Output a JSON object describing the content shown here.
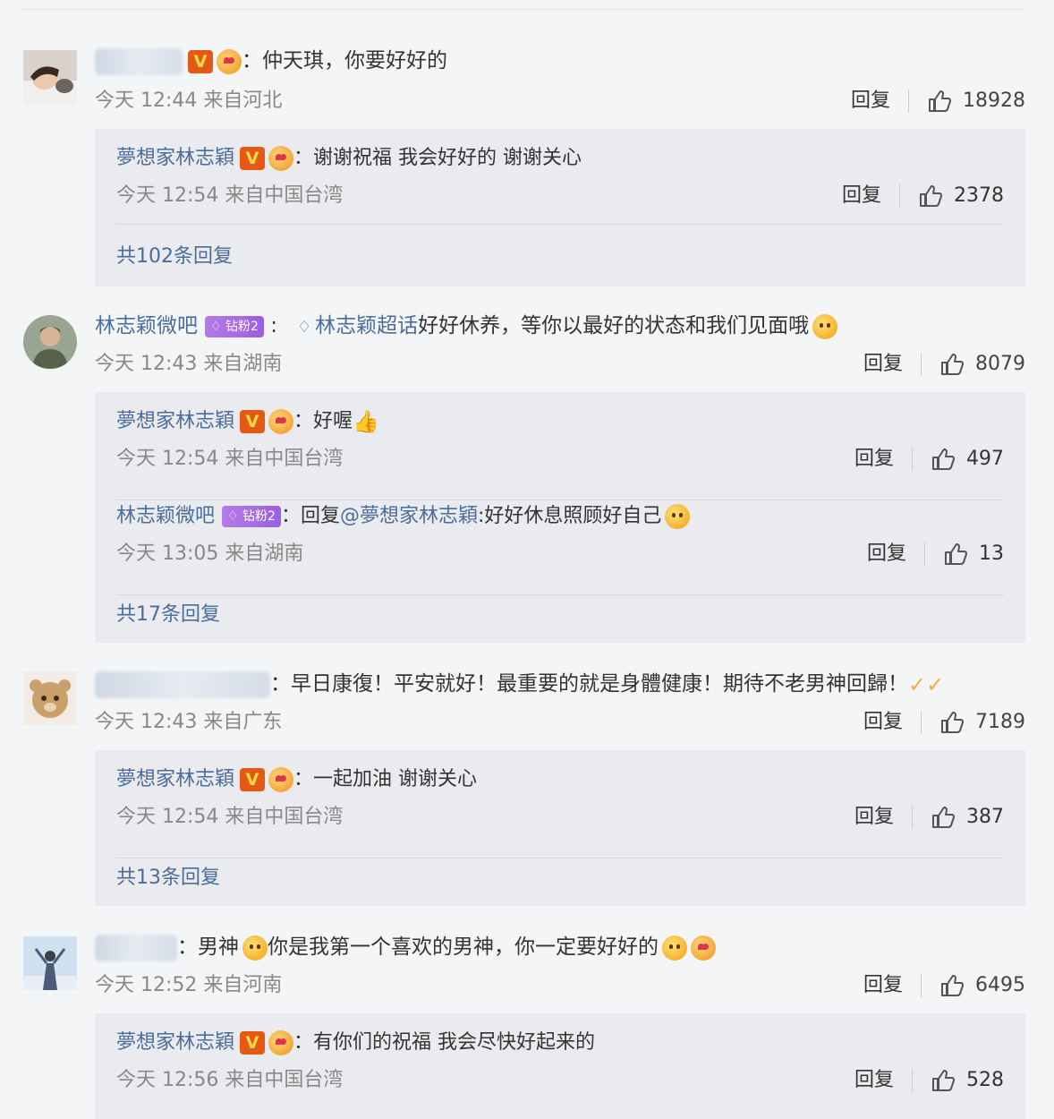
{
  "comments": [
    {
      "text": "：仲天琪，你要好好的",
      "meta": "今天 12:44 来自河北",
      "reply_label": "回复",
      "likes": "18928",
      "replies": [
        {
          "user": "夢想家林志穎",
          "text": "：谢谢祝福 我会好好的 谢谢关心",
          "meta": "今天 12:54 来自中国台湾",
          "reply_label": "回复",
          "likes": "2378"
        }
      ],
      "more": "共102条回复"
    },
    {
      "user": "林志颖微吧",
      "fan_badge": "钻粉2",
      "mention": "林志颖超话",
      "text": "好好休养，等你以最好的状态和我们见面哦",
      "meta": "今天 12:43 来自湖南",
      "reply_label": "回复",
      "likes": "8079",
      "replies": [
        {
          "user": "夢想家林志穎",
          "text": "：好喔",
          "meta": "今天 12:54 来自中国台湾",
          "reply_label": "回复",
          "likes": "497"
        },
        {
          "user": "林志颖微吧",
          "fan_badge": "钻粉2",
          "text_prefix": "：回复",
          "mention": "@夢想家林志穎",
          "text": ":好好休息照顾好自己",
          "meta": "今天 13:05 来自湖南",
          "reply_label": "回复",
          "likes": "13"
        }
      ],
      "more": "共17条回复"
    },
    {
      "text": "：早日康復！平安就好！最重要的就是身體健康！期待不老男神回歸！",
      "meta": "今天 12:43 来自广东",
      "reply_label": "回复",
      "likes": "7189",
      "replies": [
        {
          "user": "夢想家林志穎",
          "text": "：一起加油 谢谢关心",
          "meta": "今天 12:54 来自中国台湾",
          "reply_label": "回复",
          "likes": "387"
        }
      ],
      "more": "共13条回复"
    },
    {
      "text_a": "：男神",
      "text_b": "你是我第一个喜欢的男神，你一定要好好的",
      "meta": "今天 12:52 来自河南",
      "reply_label": "回复",
      "likes": "6495",
      "replies": [
        {
          "user": "夢想家林志穎",
          "text": "：有你们的祝福 我会尽快好起来的",
          "meta": "今天 12:56 来自中国台湾",
          "reply_label": "回复",
          "likes": "528"
        }
      ]
    }
  ],
  "badges": {
    "verified": "V"
  },
  "colors": {
    "link": "#4a6d9c",
    "reply_bg": "#eaebee",
    "page_bg": "#f4f5f7",
    "vip": "#e45a15"
  },
  "icons": [
    "like-icon",
    "verified-badge-icon",
    "emoji-icon",
    "diamond-icon"
  ]
}
